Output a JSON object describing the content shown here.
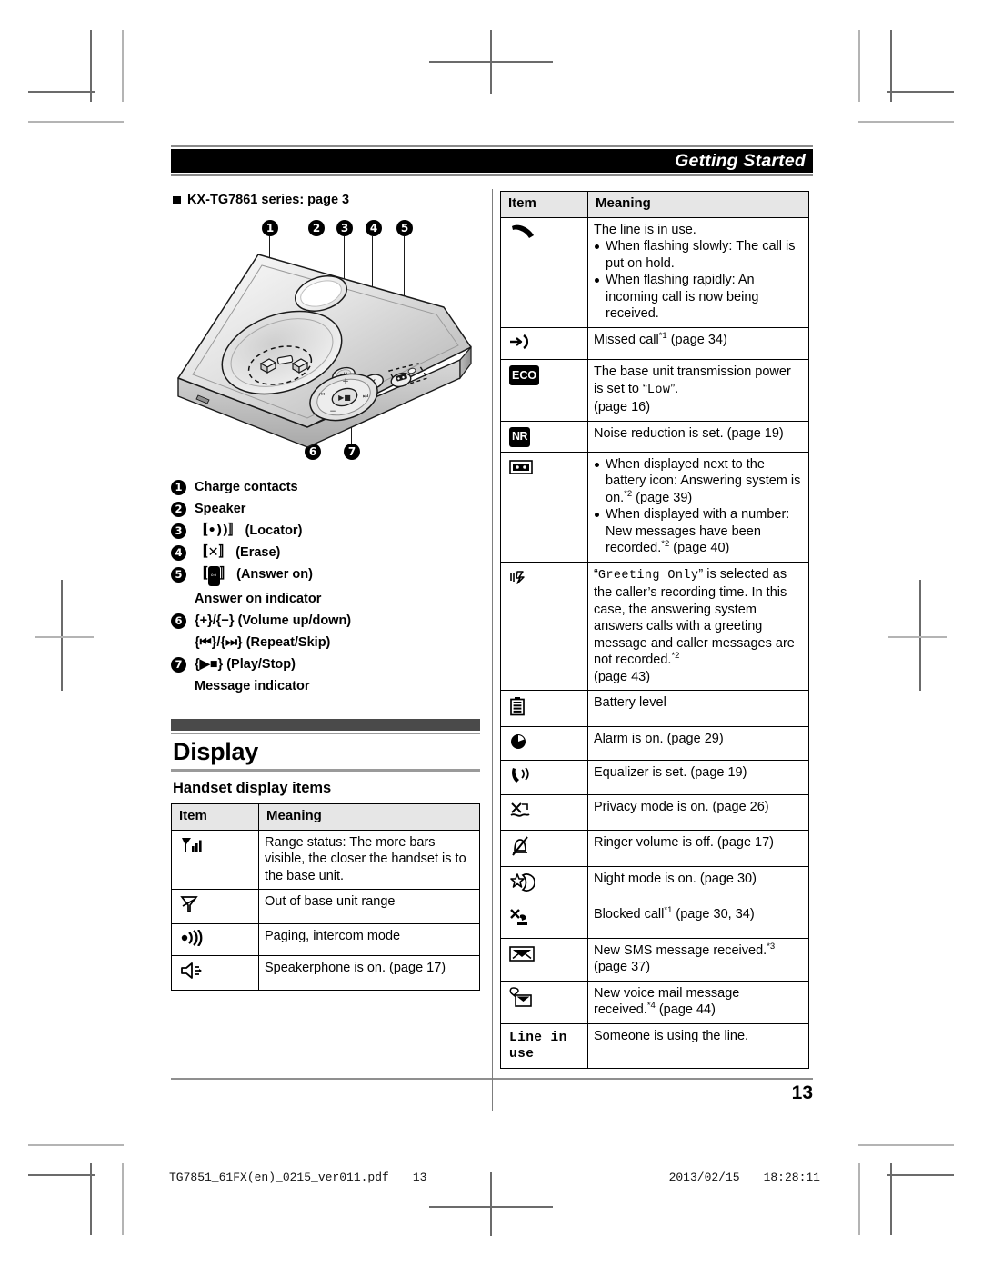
{
  "header": {
    "running_head": "Getting Started"
  },
  "left": {
    "series_heading": "KX-TG7861 series: page 3",
    "callouts": [
      "1",
      "2",
      "3",
      "4",
      "5",
      "6",
      "7"
    ],
    "legend": [
      {
        "num": "1",
        "text": "Charge contacts"
      },
      {
        "num": "2",
        "text": "Speaker"
      },
      {
        "num": "3",
        "text": "{•))} (Locator)",
        "key": "(Locator)"
      },
      {
        "num": "4",
        "text": "{✕} (Erase)",
        "key": "(Erase)"
      },
      {
        "num": "5",
        "text": "{□} (Answer on)",
        "key": "(Answer on)",
        "sub": "Answer on indicator"
      },
      {
        "num": "6",
        "text": "{+}/{−} (Volume up/down)",
        "sub": "{⏮}/{⏭} (Repeat/Skip)"
      },
      {
        "num": "7",
        "text": "{▶■} (Play/Stop)",
        "sub": "Message indicator"
      }
    ],
    "section_title": "Display",
    "sub_title": "Handset display items",
    "table": {
      "headers": [
        "Item",
        "Meaning"
      ],
      "rows": [
        {
          "icon": "signal-bars-icon",
          "meaning": "Range status: The more bars visible, the closer the handset is to the base unit."
        },
        {
          "icon": "out-of-range-icon",
          "meaning": "Out of base unit range"
        },
        {
          "icon": "paging-icon",
          "meaning": "Paging, intercom mode"
        },
        {
          "icon": "speakerphone-icon",
          "meaning": "Speakerphone is on. (page 17)"
        }
      ]
    }
  },
  "right": {
    "table": {
      "headers": [
        "Item",
        "Meaning"
      ],
      "rows": [
        {
          "icon": "handset-offhook-icon",
          "lead": "The line is in use.",
          "bullets": [
            "When flashing slowly: The call is put on hold.",
            "When flashing rapidly: An incoming call is now being received."
          ]
        },
        {
          "icon": "missed-call-icon",
          "lead": "Missed call*1 (page 34)"
        },
        {
          "icon": "eco-badge-icon",
          "badge": "ECO",
          "lead": "The base unit transmission power is set to “Low”. (page 16)",
          "mono_word": "Low"
        },
        {
          "icon": "nr-badge-icon",
          "badge": "NR",
          "lead": "Noise reduction is set. (page 19)"
        },
        {
          "icon": "answering-system-icon",
          "bullets": [
            "When displayed next to the battery icon: Answering system is on.*2 (page 39)",
            "When displayed with a number: New messages have been recorded.*2 (page 40)"
          ]
        },
        {
          "icon": "greeting-only-icon",
          "lead": "“Greeting Only” is selected as the caller’s recording time. In this case, the answering system answers calls with a greeting message and caller messages are not recorded.*2 (page 43)",
          "mono_word": "Greeting Only"
        },
        {
          "icon": "battery-icon",
          "lead": "Battery level"
        },
        {
          "icon": "alarm-clock-icon",
          "lead": "Alarm is on. (page 29)"
        },
        {
          "icon": "equalizer-icon",
          "lead": "Equalizer is set. (page 19)"
        },
        {
          "icon": "privacy-mode-icon",
          "lead": "Privacy mode is on. (page 26)"
        },
        {
          "icon": "ringer-off-icon",
          "lead": "Ringer volume is off. (page 17)"
        },
        {
          "icon": "night-mode-icon",
          "lead": "Night mode is on. (page 30)"
        },
        {
          "icon": "blocked-call-icon",
          "lead": "Blocked call*1 (page 30, 34)"
        },
        {
          "icon": "sms-message-icon",
          "lead": "New SMS message received.*3 (page 37)"
        },
        {
          "icon": "voice-mail-icon",
          "lead": "New voice mail message received.*4 (page 44)"
        },
        {
          "icon": "line-in-use-text",
          "item_text": "Line in use",
          "lead": "Someone is using the line."
        }
      ]
    }
  },
  "page_number": "13",
  "print_footer": {
    "file": "TG7851_61FX(en)_0215_ver011.pdf",
    "page": "13",
    "date": "2013/02/15",
    "time": "18:28:11"
  }
}
